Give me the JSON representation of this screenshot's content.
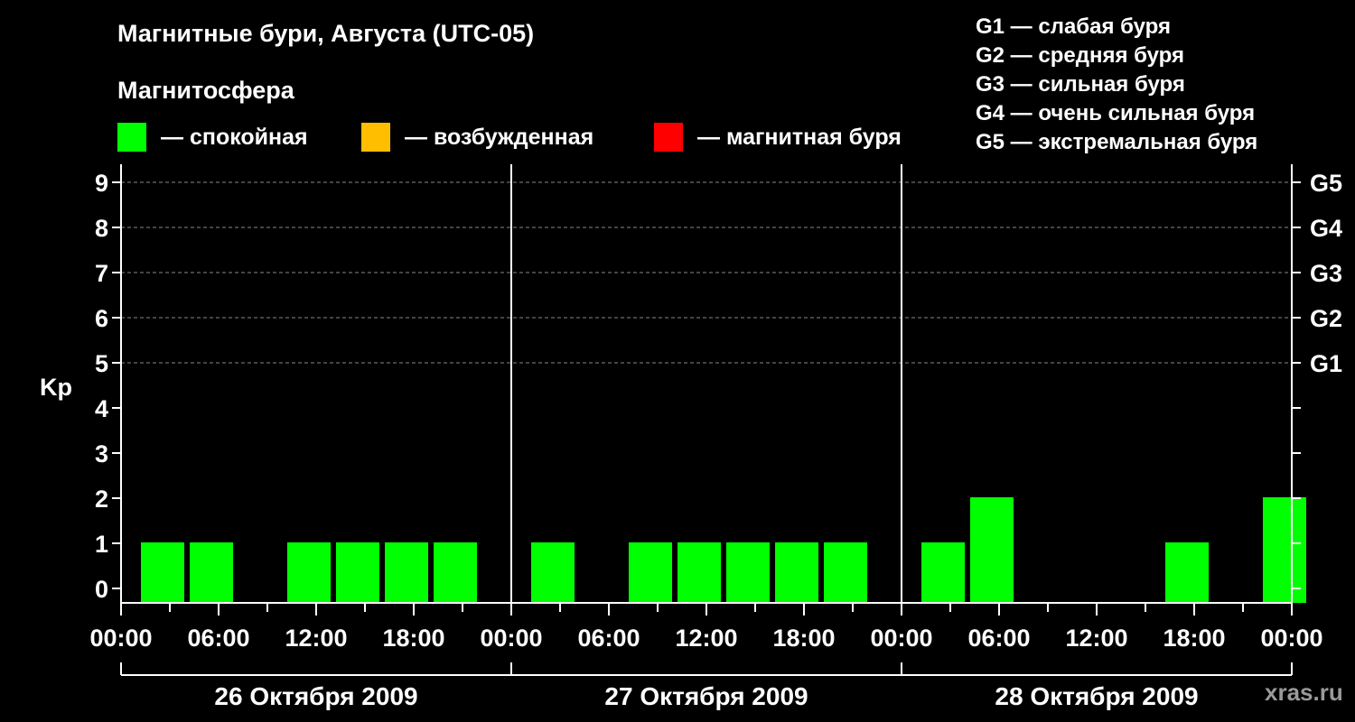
{
  "title": "Магнитные бури, Августа (UTC-05)",
  "subtitle": "Магнитосфера",
  "legend": [
    {
      "label": "— спокойная",
      "color": "#00ff00"
    },
    {
      "label": "— возбужденная",
      "color": "#ffbf00"
    },
    {
      "label": "— магнитная буря",
      "color": "#ff0000"
    }
  ],
  "g_legend": [
    "G1 — слабая буря",
    "G2 — средняя буря",
    "G3 — сильная буря",
    "G4 — очень сильная буря",
    "G5 — экстремальная буря"
  ],
  "brand": "xras.ru",
  "chart_data": {
    "type": "bar",
    "ylabel": "Kp",
    "ylim": [
      0,
      9
    ],
    "y_ticks": [
      "0",
      "1",
      "2",
      "3",
      "4",
      "5",
      "6",
      "7",
      "8",
      "9"
    ],
    "right_ticks": [
      {
        "value": 5,
        "label": "G1"
      },
      {
        "value": 6,
        "label": "G2"
      },
      {
        "value": 7,
        "label": "G3"
      },
      {
        "value": 8,
        "label": "G4"
      },
      {
        "value": 9,
        "label": "G5"
      }
    ],
    "grid_y_values": [
      5,
      6,
      7,
      8,
      9
    ],
    "x_tick_labels": [
      "00:00",
      "06:00",
      "12:00",
      "18:00",
      "00:00",
      "06:00",
      "12:00",
      "18:00",
      "00:00",
      "06:00",
      "12:00",
      "18:00",
      "00:00"
    ],
    "days": [
      "26 Октября 2009",
      "27 Октября 2009",
      "28 Октября 2009"
    ],
    "bar_color": "#00ff00",
    "categories": [
      "26 00-03",
      "26 03-06",
      "26 06-09",
      "26 09-12",
      "26 12-15",
      "26 15-18",
      "26 18-21",
      "26 21-24",
      "27 00-03",
      "27 03-06",
      "27 06-09",
      "27 09-12",
      "27 12-15",
      "27 15-18",
      "27 18-21",
      "27 21-24",
      "28 00-03",
      "28 03-06",
      "28 06-09",
      "28 09-12",
      "28 12-15",
      "28 15-18",
      "28 18-21",
      "28 21-24"
    ],
    "values": [
      1,
      1,
      0,
      1,
      1,
      1,
      1,
      0,
      1,
      0,
      1,
      1,
      1,
      1,
      1,
      0,
      1,
      2,
      0,
      0,
      0,
      1,
      0,
      2
    ]
  }
}
